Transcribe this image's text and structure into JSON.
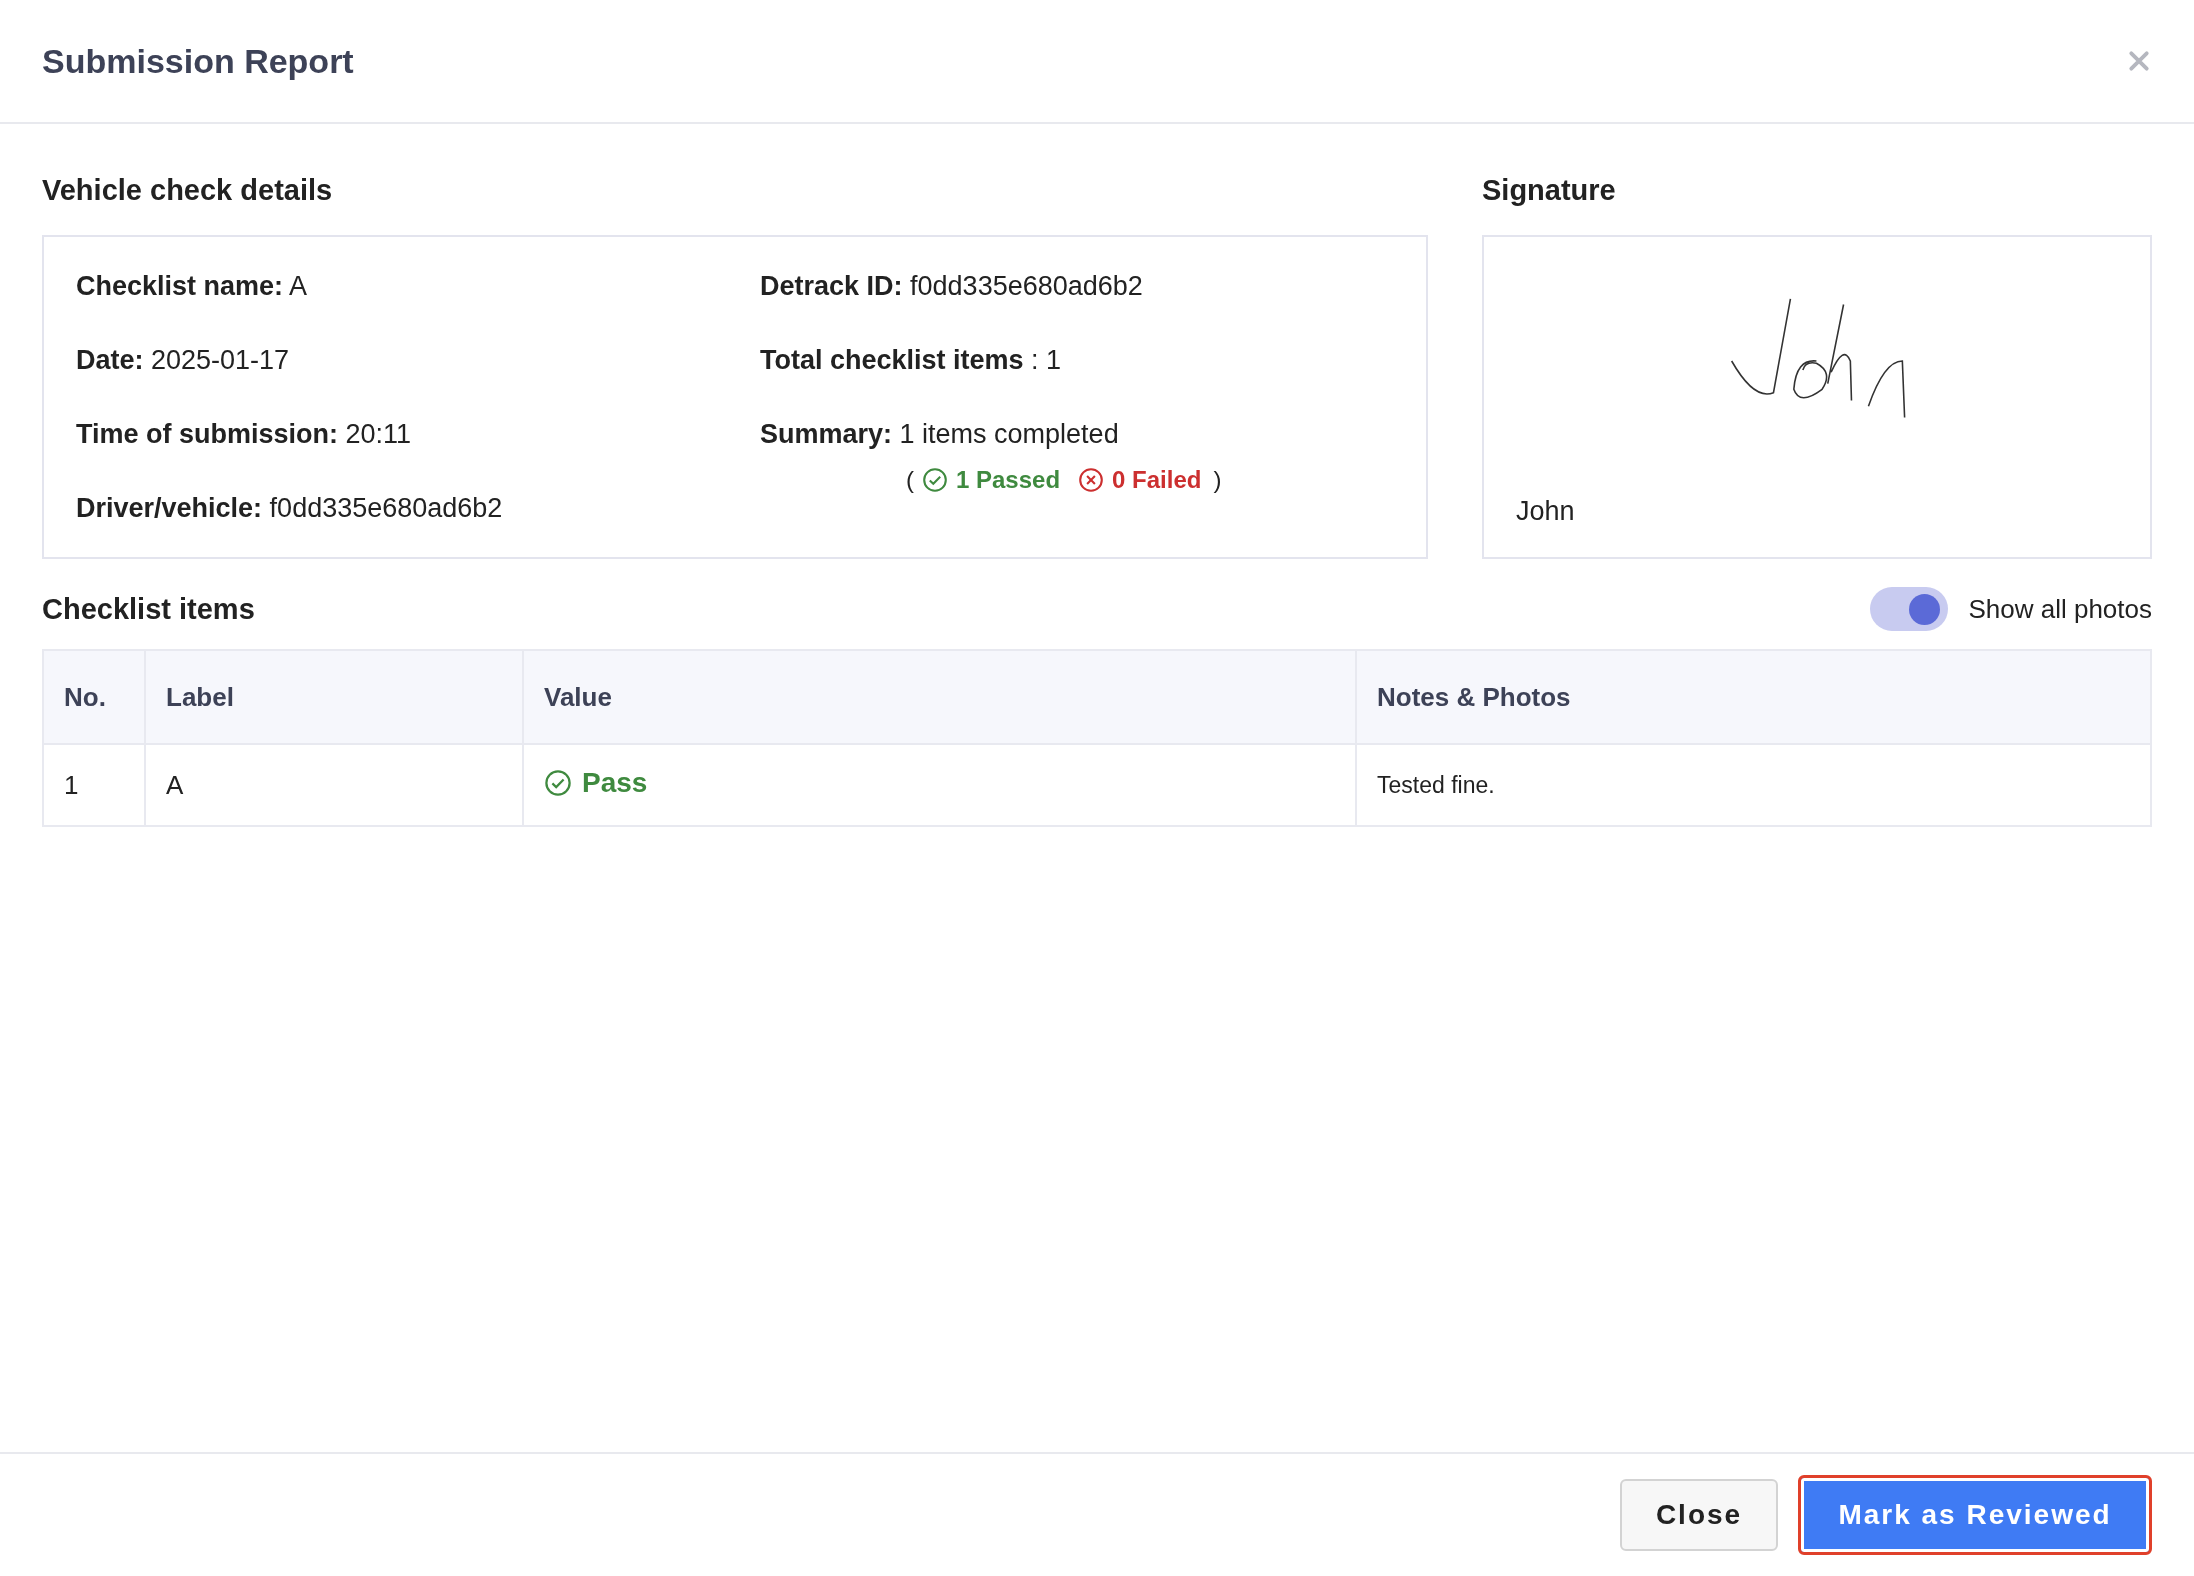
{
  "dialog": {
    "title": "Submission Report"
  },
  "details": {
    "heading": "Vehicle check details",
    "fields": [
      {
        "label": "Checklist name:",
        "value": "A"
      },
      {
        "label": "Detrack ID:",
        "value": "f0dd335e680ad6b2"
      },
      {
        "label": "Date:",
        "value": "2025-01-17"
      },
      {
        "label": "Total checklist items",
        "value": ": 1"
      },
      {
        "label": "Time of submission:",
        "value": "20:11"
      },
      {
        "label": "Summary:",
        "value": "1 items completed",
        "breakdown": {
          "open": "(",
          "passed": "1 Passed",
          "failed": "0 Failed",
          "close": ")"
        }
      },
      {
        "label": "Driver/vehicle:",
        "value": "f0dd335e680ad6b2"
      }
    ]
  },
  "signature": {
    "heading": "Signature",
    "name": "John"
  },
  "checklist": {
    "heading": "Checklist items",
    "toggle": {
      "label": "Show all photos",
      "on": true
    },
    "columns": [
      "No.",
      "Label",
      "Value",
      "Notes & Photos"
    ],
    "rows": [
      {
        "no": "1",
        "label": "A",
        "value": {
          "text": "Pass",
          "kind": "pass"
        },
        "notes": "Tested fine."
      }
    ]
  },
  "buttons": [
    {
      "label": "Close",
      "kind": "secondary",
      "focused": false
    },
    {
      "label": "Mark as Reviewed",
      "kind": "primary",
      "focused": true
    }
  ]
}
